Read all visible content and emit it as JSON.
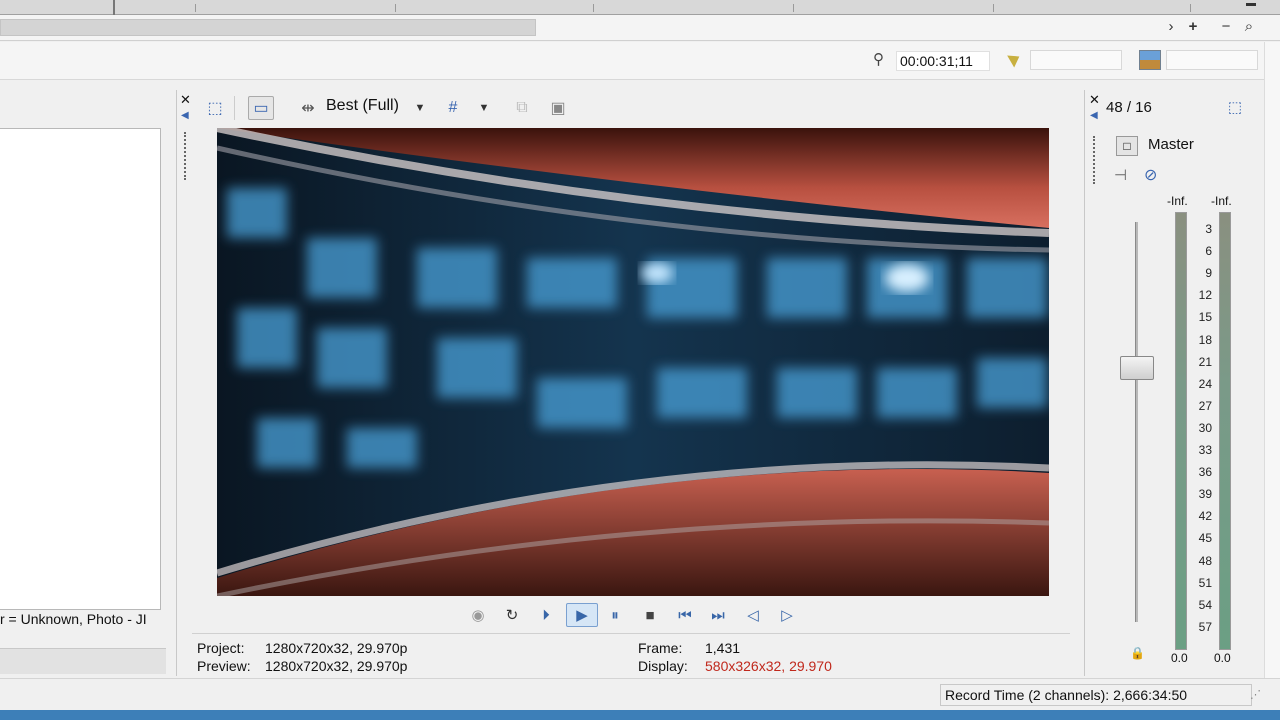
{
  "timeline": {
    "timecode": "00:00:31;11"
  },
  "left_panel": {
    "status_text": "r = Unknown, Photo - JI"
  },
  "preview": {
    "quality": "Best (Full)",
    "close_glyph": "✕",
    "transport": [
      "record-icon",
      "loop-icon",
      "play-from-start-icon",
      "play-icon",
      "pause-icon",
      "stop-icon",
      "prev-frame-icon",
      "next-frame-icon",
      "prev-marker-icon",
      "next-marker-icon"
    ],
    "project_label": "Project:",
    "project_value": "1280x720x32, 29.970p",
    "preview_label": "Preview:",
    "preview_value": "1280x720x32, 29.970p",
    "frame_label": "Frame:",
    "frame_value": "1,431",
    "display_label": "Display:",
    "display_value": "580x326x32, 29.970",
    "display_color": "#c0281c"
  },
  "mixer": {
    "count": "48 / 16",
    "master_label": "Master",
    "left_peak": "-Inf.",
    "right_peak": "-Inf.",
    "scale": [
      "3",
      "6",
      "9",
      "12",
      "15",
      "18",
      "21",
      "24",
      "27",
      "30",
      "33",
      "36",
      "39",
      "42",
      "45",
      "48",
      "51",
      "54",
      "57"
    ],
    "left_level": "0.0",
    "right_level": "0.0"
  },
  "status": {
    "record_time": "Record Time (2 channels): 2,666:34:50"
  },
  "colors": {
    "accent": "#3a66b0",
    "titlebar": "#3d7fb8"
  }
}
